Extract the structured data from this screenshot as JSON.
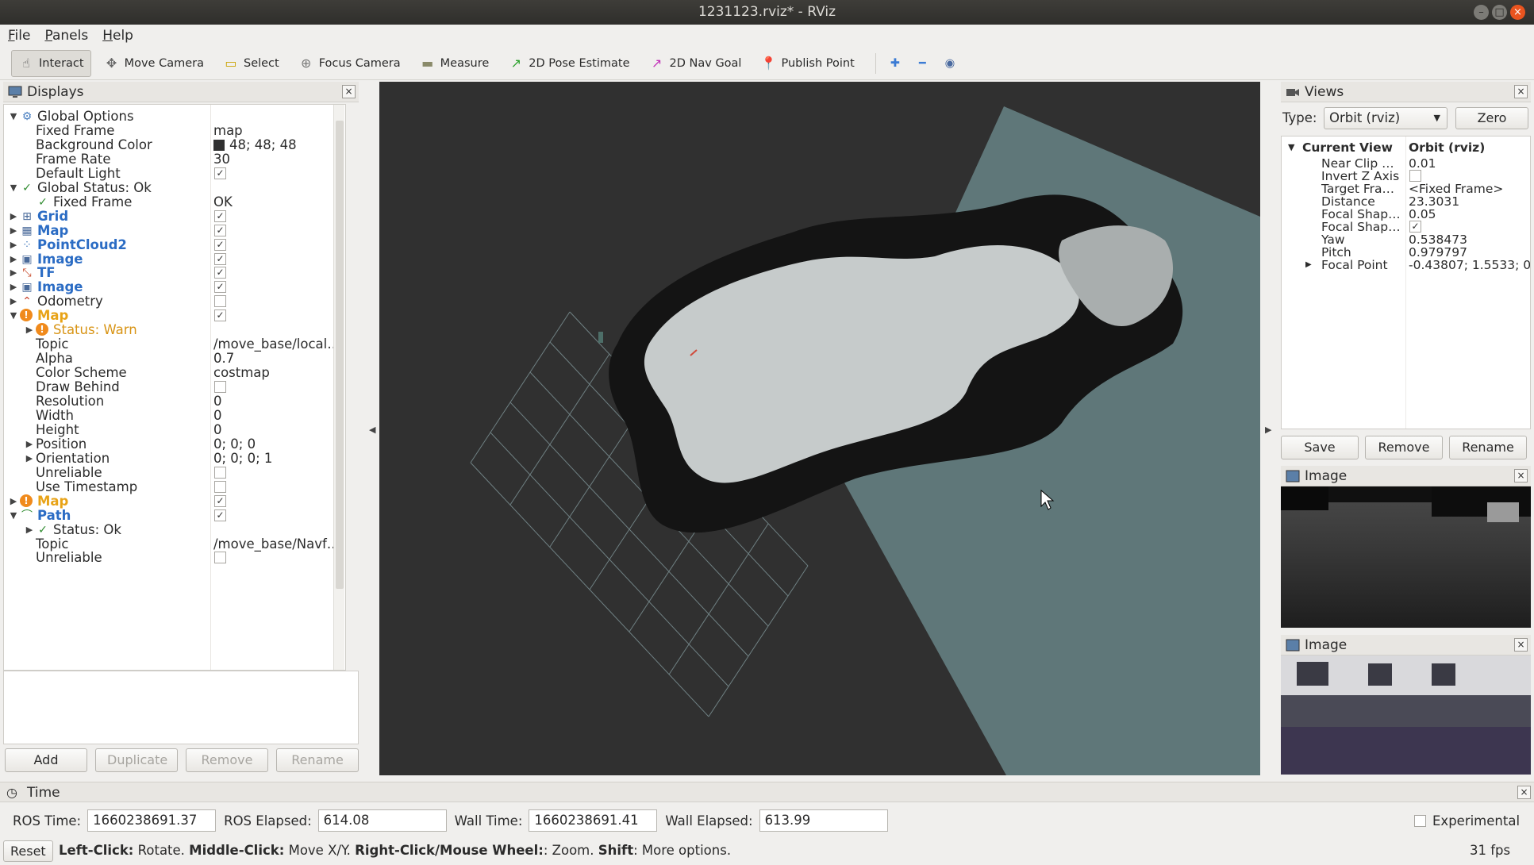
{
  "window": {
    "title": "1231123.rviz* - RViz"
  },
  "menu": [
    {
      "pre": "",
      "u": "F",
      "post": "ile"
    },
    {
      "pre": "",
      "u": "P",
      "post": "anels"
    },
    {
      "pre": "",
      "u": "H",
      "post": "elp"
    }
  ],
  "toolbar": {
    "tools": [
      {
        "label": "Interact",
        "icon": "interact-icon",
        "glyph": "☝",
        "color": "#555"
      },
      {
        "label": "Move Camera",
        "icon": "move-camera-icon",
        "glyph": "✥",
        "color": "#666"
      },
      {
        "label": "Select",
        "icon": "select-icon",
        "glyph": "▭",
        "color": "#c9a200"
      },
      {
        "label": "Focus Camera",
        "icon": "focus-camera-icon",
        "glyph": "⊕",
        "color": "#777"
      },
      {
        "label": "Measure",
        "icon": "measure-icon",
        "glyph": "▬",
        "color": "#8a8a6a"
      },
      {
        "label": "2D Pose Estimate",
        "icon": "pose-estimate-icon",
        "glyph": "↗",
        "color": "#2aa02a"
      },
      {
        "label": "2D Nav Goal",
        "icon": "nav-goal-icon",
        "glyph": "↗",
        "color": "#c22fb8"
      },
      {
        "label": "Publish Point",
        "icon": "publish-point-icon",
        "glyph": "📍",
        "color": "#d4452a"
      }
    ]
  },
  "displays": {
    "title": "Displays",
    "rows": [
      {
        "depth": 0,
        "arrow": "▼",
        "icon": "gear-icon",
        "glyph": "⚙",
        "iconColor": "#4a7fc0",
        "name": "Global Options",
        "style": "",
        "value": "",
        "check": null
      },
      {
        "depth": 1,
        "arrow": "",
        "icon": "",
        "glyph": "",
        "name": "Fixed Frame",
        "style": "",
        "value": "map",
        "check": null
      },
      {
        "depth": 1,
        "arrow": "",
        "icon": "",
        "glyph": "",
        "name": "Background Color",
        "style": "",
        "value": "48; 48; 48",
        "swatch": true,
        "check": null
      },
      {
        "depth": 1,
        "arrow": "",
        "icon": "",
        "glyph": "",
        "name": "Frame Rate",
        "style": "",
        "value": "30",
        "check": null
      },
      {
        "depth": 1,
        "arrow": "",
        "icon": "",
        "glyph": "",
        "name": "Default Light",
        "style": "",
        "value": "",
        "check": true
      },
      {
        "depth": 0,
        "arrow": "▼",
        "icon": "check-icon",
        "glyph": "✓",
        "iconColor": "#2e8b2e",
        "name": "Global Status: Ok",
        "style": "",
        "value": "",
        "check": null
      },
      {
        "depth": 1,
        "arrow": "",
        "icon": "check-icon",
        "glyph": "✓",
        "iconColor": "#2e8b2e",
        "name": "Fixed Frame",
        "style": "",
        "value": "OK",
        "check": null,
        "indentIcon": true
      },
      {
        "depth": 0,
        "arrow": "▶",
        "icon": "grid-icon",
        "glyph": "⊞",
        "iconColor": "#4a6a9a",
        "name": "Grid",
        "style": "blue",
        "value": "",
        "check": true
      },
      {
        "depth": 0,
        "arrow": "▶",
        "icon": "map-icon",
        "glyph": "▦",
        "iconColor": "#4a6a9a",
        "name": "Map",
        "style": "blue",
        "value": "",
        "check": true
      },
      {
        "depth": 0,
        "arrow": "▶",
        "icon": "pointcloud-icon",
        "glyph": "⁘",
        "iconColor": "#4a7fc0",
        "name": "PointCloud2",
        "style": "blue",
        "value": "",
        "check": true
      },
      {
        "depth": 0,
        "arrow": "▶",
        "icon": "image-icon",
        "glyph": "▣",
        "iconColor": "#4a6a9a",
        "name": "Image",
        "style": "blue",
        "value": "",
        "check": true
      },
      {
        "depth": 0,
        "arrow": "▶",
        "icon": "tf-icon",
        "glyph": "⤡",
        "iconColor": "#c84a2a",
        "name": "TF",
        "style": "blue",
        "value": "",
        "check": true
      },
      {
        "depth": 0,
        "arrow": "▶",
        "icon": "image-icon",
        "glyph": "▣",
        "iconColor": "#4a6a9a",
        "name": "Image",
        "style": "blue",
        "value": "",
        "check": true
      },
      {
        "depth": 0,
        "arrow": "▶",
        "icon": "odometry-icon",
        "glyph": "⌃",
        "iconColor": "#c8402a",
        "name": "Odometry",
        "style": "",
        "value": "",
        "check": false
      },
      {
        "depth": 0,
        "arrow": "▼",
        "icon": "warning-icon",
        "glyph": "!",
        "iconColor": "#f08a1c",
        "name": "Map",
        "style": "orange",
        "value": "",
        "check": true,
        "warnIcon": true
      },
      {
        "depth": 1,
        "arrow": "▶",
        "icon": "warning-icon",
        "glyph": "!",
        "iconColor": "#f08a1c",
        "name": "Status: Warn",
        "style": "warn",
        "value": "",
        "check": null,
        "warnIcon": true,
        "indentIcon": true
      },
      {
        "depth": 1,
        "arrow": "",
        "icon": "",
        "glyph": "",
        "name": "Topic",
        "style": "",
        "value": "/move_base/local…",
        "check": null
      },
      {
        "depth": 1,
        "arrow": "",
        "icon": "",
        "glyph": "",
        "name": "Alpha",
        "style": "",
        "value": "0.7",
        "check": null
      },
      {
        "depth": 1,
        "arrow": "",
        "icon": "",
        "glyph": "",
        "name": "Color Scheme",
        "style": "",
        "value": "costmap",
        "check": null
      },
      {
        "depth": 1,
        "arrow": "",
        "icon": "",
        "glyph": "",
        "name": "Draw Behind",
        "style": "",
        "value": "",
        "check": false
      },
      {
        "depth": 1,
        "arrow": "",
        "icon": "",
        "glyph": "",
        "name": "Resolution",
        "style": "",
        "value": "0",
        "check": null
      },
      {
        "depth": 1,
        "arrow": "",
        "icon": "",
        "glyph": "",
        "name": "Width",
        "style": "",
        "value": "0",
        "check": null
      },
      {
        "depth": 1,
        "arrow": "",
        "icon": "",
        "glyph": "",
        "name": "Height",
        "style": "",
        "value": "0",
        "check": null
      },
      {
        "depth": 1,
        "arrow": "▶",
        "icon": "",
        "glyph": "",
        "name": "Position",
        "style": "",
        "value": "0; 0; 0",
        "check": null
      },
      {
        "depth": 1,
        "arrow": "▶",
        "icon": "",
        "glyph": "",
        "name": "Orientation",
        "style": "",
        "value": "0; 0; 0; 1",
        "check": null
      },
      {
        "depth": 1,
        "arrow": "",
        "icon": "",
        "glyph": "",
        "name": "Unreliable",
        "style": "",
        "value": "",
        "check": false
      },
      {
        "depth": 1,
        "arrow": "",
        "icon": "",
        "glyph": "",
        "name": "Use Timestamp",
        "style": "",
        "value": "",
        "check": false
      },
      {
        "depth": 0,
        "arrow": "▶",
        "icon": "warning-icon",
        "glyph": "!",
        "iconColor": "#f08a1c",
        "name": "Map",
        "style": "orange",
        "value": "",
        "check": true,
        "warnIcon": true
      },
      {
        "depth": 0,
        "arrow": "▼",
        "icon": "path-icon",
        "glyph": "⌒",
        "iconColor": "#2e8b2e",
        "name": "Path",
        "style": "blue",
        "value": "",
        "check": true
      },
      {
        "depth": 1,
        "arrow": "▶",
        "icon": "check-icon",
        "glyph": "✓",
        "iconColor": "#2e8b2e",
        "name": "Status: Ok",
        "style": "",
        "value": "",
        "check": null,
        "indentIcon": true
      },
      {
        "depth": 1,
        "arrow": "",
        "icon": "",
        "glyph": "",
        "name": "Topic",
        "style": "",
        "value": "/move_base/Navf…",
        "check": null
      },
      {
        "depth": 1,
        "arrow": "",
        "icon": "",
        "glyph": "",
        "name": "Unreliable",
        "style": "",
        "value": "",
        "check": false
      }
    ],
    "buttons": {
      "add": "Add",
      "duplicate": "Duplicate",
      "remove": "Remove",
      "rename": "Rename"
    }
  },
  "views": {
    "title": "Views",
    "type_label": "Type:",
    "type_value": "Orbit (rviz)",
    "zero_label": "Zero",
    "header_key": "Current View",
    "header_value": "Orbit (rviz)",
    "rows": [
      {
        "k": "Near Clip …",
        "v": "0.01"
      },
      {
        "k": "Invert Z Axis",
        "v": "",
        "check": false
      },
      {
        "k": "Target Fra…",
        "v": "<Fixed Frame>"
      },
      {
        "k": "Distance",
        "v": "23.3031"
      },
      {
        "k": "Focal Shap…",
        "v": "0.05"
      },
      {
        "k": "Focal Shap…",
        "v": "",
        "check": true
      },
      {
        "k": "Yaw",
        "v": "0.538473"
      },
      {
        "k": "Pitch",
        "v": "0.979797"
      },
      {
        "k": "Focal Point",
        "v": "-0.43807; 1.5533; 0.",
        "arrow": "▶"
      }
    ],
    "buttons": {
      "save": "Save",
      "remove": "Remove",
      "rename": "Rename"
    }
  },
  "image_panels": [
    {
      "title": "Image"
    },
    {
      "title": "Image"
    }
  ],
  "time": {
    "title": "Time",
    "ros_time_label": "ROS Time:",
    "ros_time": "1660238691.37",
    "ros_elapsed_label": "ROS Elapsed:",
    "ros_elapsed": "614.08",
    "wall_time_label": "Wall Time:",
    "wall_time": "1660238691.41",
    "wall_elapsed_label": "Wall Elapsed:",
    "wall_elapsed": "613.99",
    "experimental_label": "Experimental"
  },
  "status": {
    "reset_label": "Reset",
    "hint_parts": [
      {
        "b": "Left-Click:",
        "t": " Rotate. "
      },
      {
        "b": "Middle-Click:",
        "t": " Move X/Y. "
      },
      {
        "b": "Right-Click/Mouse Wheel:",
        "t": ": Zoom. "
      },
      {
        "b": "Shift",
        "t": ": More options."
      }
    ],
    "fps": "31 fps"
  }
}
